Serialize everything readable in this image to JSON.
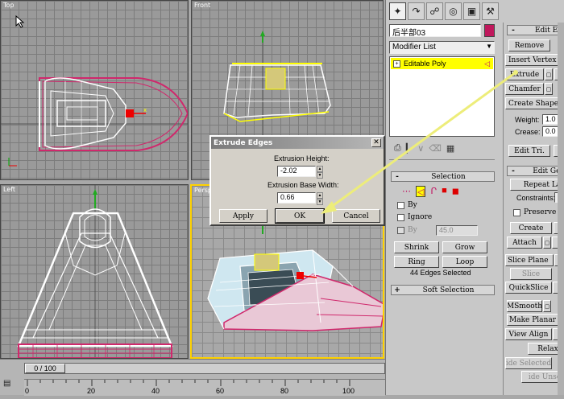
{
  "viewports": {
    "top": {
      "label": "Top"
    },
    "front": {
      "label": "Front"
    },
    "left": {
      "label": "Left"
    },
    "perspective": {
      "label": "Perspective"
    }
  },
  "panel": {
    "object_name": "后半部03",
    "object_color": "#c0185c",
    "modifier_list": "Modifier List",
    "stack_item": "Editable Poly",
    "tabs": [
      "create-icon",
      "modify-icon",
      "hierarchy-icon",
      "motion-icon",
      "display-icon",
      "utilities-icon"
    ]
  },
  "edit_edges": {
    "header": "Edit Ed",
    "remove": "Remove",
    "insert_vertex": "Insert Vertex",
    "extrude": "Extrude",
    "chamfer": "Chamfer",
    "create_shape": "Create Shape From",
    "weight_label": "Weight:",
    "weight_value": "1.0",
    "crease_label": "Crease:",
    "crease_value": "0.0",
    "edit_tri": "Edit Tri."
  },
  "selection": {
    "header": "Selection",
    "by_vertex": "By",
    "ignore": "Ignore",
    "by_angle": "By",
    "angle_value": "45.0",
    "shrink": "Shrink",
    "grow": "Grow",
    "ring": "Ring",
    "loop": "Loop",
    "status": "44 Edges Selected",
    "soft_selection": "Soft Selection"
  },
  "edit_geometry": {
    "header": "Edit Geo",
    "repeat_last": "Repeat La",
    "constraints_label": "Constraints:",
    "constraints_value": "N",
    "preserve": "Preserve",
    "create": "Create",
    "attach": "Attach",
    "slice_plane": "Slice Plane",
    "slice": "Slice",
    "quickslice": "QuickSlice",
    "msmooth": "MSmooth",
    "make_planar": "Make Planar",
    "view_align": "View Align",
    "relax": "Relax",
    "hide_selected": "ide Selected",
    "hide_unselected": "ide Unse"
  },
  "dialog": {
    "title": "Extrude Edges",
    "height_label": "Extrusion Height:",
    "height_value": "-2.02",
    "width_label": "Extrusion Base Width:",
    "width_value": "0.66",
    "apply": "Apply",
    "ok": "OK",
    "cancel": "Cancel"
  },
  "timeline": {
    "frame": "0 / 100",
    "ticks": [
      "0",
      "20",
      "40",
      "60",
      "80",
      "100"
    ]
  },
  "colors": {
    "active_border": "#ffd200",
    "arrow": "#f0f07a",
    "selected_stack": "#ffff00"
  }
}
